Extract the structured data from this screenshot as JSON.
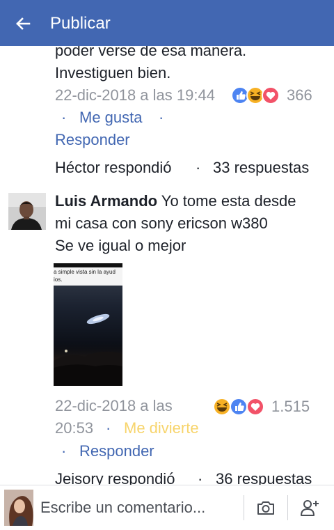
{
  "header": {
    "title": "Publicar",
    "back_icon": "arrow-left-icon"
  },
  "prev_comment": {
    "text_lines": [
      "poder verse de esa manera.",
      "Investiguen bien."
    ],
    "timestamp": "22-dic-2018 a las 19:44",
    "reactions": [
      "like",
      "haha",
      "love"
    ],
    "reaction_count": "366",
    "like_label": "Me gusta",
    "reply_label": "Responder",
    "replies_author": "Héctor respondió",
    "replies_count": "33 respuestas"
  },
  "comment": {
    "author": "Luis Armando",
    "text_lines": [
      " Yo tome esta desde",
      "mi casa con sony ericson w380",
      "Se ve igual o mejor"
    ],
    "attachment_caption_lines": [
      "a simple vista sin la ayud",
      "ios."
    ],
    "timestamp_line1": "22-dic-2018 a las",
    "timestamp_line2": "20:53",
    "reactions": [
      "haha",
      "like",
      "love"
    ],
    "reaction_count": "1.515",
    "reaction_label": "Me divierte",
    "reply_label": "Responder",
    "replies_author": "Jeisory respondió",
    "replies_count": "36 respuestas"
  },
  "composer": {
    "placeholder": "Escribe un comentario...",
    "camera_icon": "camera-icon",
    "tag_icon": "add-person-icon"
  },
  "colors": {
    "brand": "#4267b2",
    "meta": "#90949c",
    "haha_label": "#f7d46b",
    "love": "#f25268",
    "haha": "#f7b125"
  }
}
